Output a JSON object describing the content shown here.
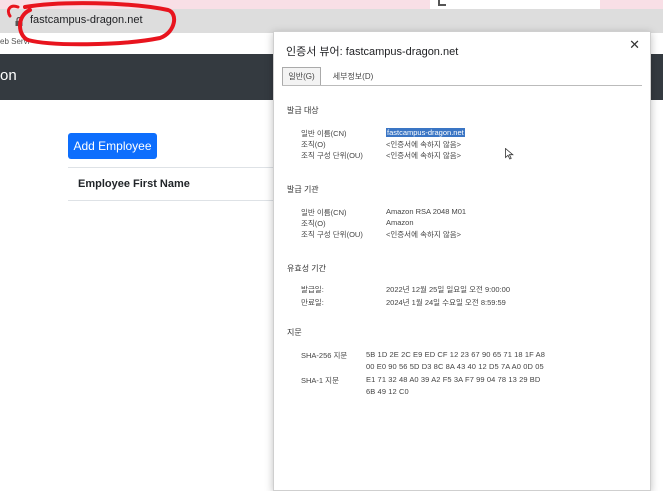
{
  "browser": {
    "url": "fastcampus-dragon.net",
    "bookmark_fragment": "eb Servi"
  },
  "site": {
    "brand_fragment": "on",
    "add_button_label": "Add Employee",
    "table_header": "Employee First Name"
  },
  "dialog": {
    "title": "인증서 뷰어: fastcampus-dragon.net",
    "tab_general": "일반(G)",
    "tab_details": "세부정보(D)",
    "issued_to": {
      "title": "발급 대상",
      "rows": [
        {
          "label": "일반 이름(CN)",
          "value": "fastcampus-dragon.net"
        },
        {
          "label": "조직(O)",
          "value": "<인증서에 속하지 않음>"
        },
        {
          "label": "조직 구성 단위(OU)",
          "value": "<인증서에 속하지 않음>"
        }
      ]
    },
    "issued_by": {
      "title": "발급 기관",
      "rows": [
        {
          "label": "일반 이름(CN)",
          "value": "Amazon RSA 2048 M01"
        },
        {
          "label": "조직(O)",
          "value": "Amazon"
        },
        {
          "label": "조직 구성 단위(OU)",
          "value": "<인증서에 속하지 않음>"
        }
      ]
    },
    "validity": {
      "title": "유효성 기간",
      "rows": [
        {
          "label": "발급일:",
          "value": "2022년 12월 25일 일요일 오전 9:00:00"
        },
        {
          "label": "만료일:",
          "value": "2024년 1월 24일 수요일 오전 8:59:59"
        }
      ]
    },
    "fingerprints": {
      "title": "지문",
      "sha256_label": "SHA-256 지문",
      "sha256_line1": "5B 1D 2E 2C E9 ED CF 12 23 67 90 65 71 18 1F A8",
      "sha256_line2": "00 E0 90 56 5D D3 8C 8A 43 40 12 D5 7A A0 0D 05",
      "sha1_label": "SHA-1 지문",
      "sha1_line1": "E1 71 32 48 A0 39 A2 F5 3A F7 99 04 78 13 29 BD",
      "sha1_line2": "6B 49 12 C0"
    }
  },
  "colors": {
    "annotation_circle": "#e8141e",
    "navbar": "#343a40",
    "primary_button": "#0d6efd",
    "selection": "#3a75c4"
  }
}
